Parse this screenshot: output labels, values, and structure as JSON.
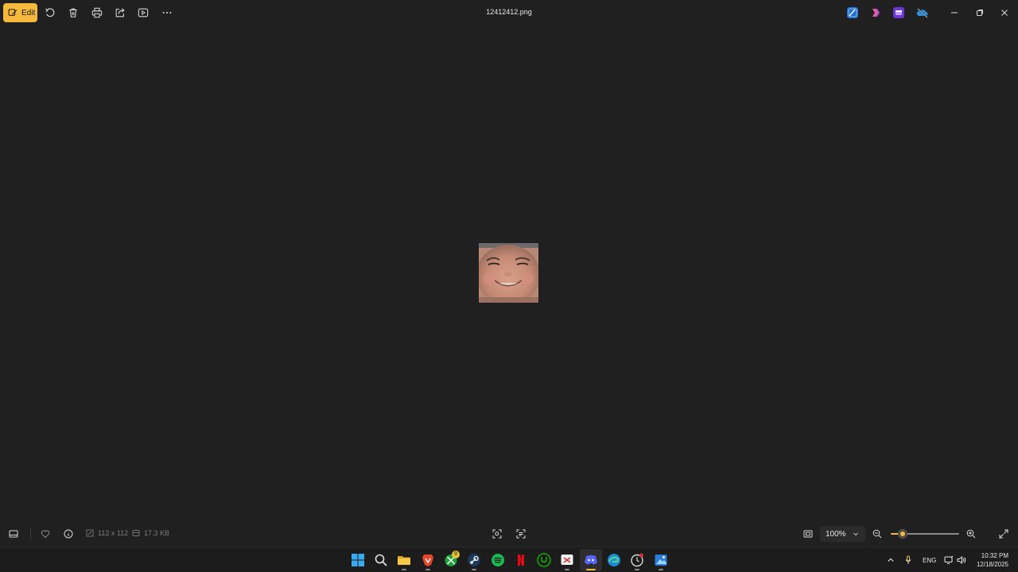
{
  "toolbar": {
    "edit_label": "Edit",
    "file_name": "12412412.png"
  },
  "status": {
    "dimensions": "112 x 112",
    "file_size": "17.3 KB",
    "zoom": "100%",
    "zoom_slider_fraction": 0.17
  },
  "tray": {
    "language": "ENG",
    "time": "10:32 PM",
    "date": "12/18/2025",
    "xbox_badge": "9"
  },
  "icons": {
    "top_left": [
      "edit-icon",
      "rotate-icon",
      "delete-icon",
      "print-icon",
      "share-icon",
      "slideshow-icon",
      "more-icon"
    ],
    "top_right": [
      "photos-editor-icon",
      "clipchamp-icon",
      "designer-icon",
      "onedrive-offline-icon"
    ],
    "taskbar": [
      "windows-start-icon",
      "search-icon",
      "file-explorer-icon",
      "brave-icon",
      "xbox-icon",
      "steam-icon",
      "spotify-icon",
      "netflix-icon",
      "upwork-icon",
      "snipping-tool-icon",
      "discord-icon",
      "edge-icon",
      "clock-app-icon",
      "photos-app-icon"
    ]
  },
  "colors": {
    "accent": "#f6b93b",
    "background": "#202020",
    "taskbar": "#1c1c1c"
  }
}
